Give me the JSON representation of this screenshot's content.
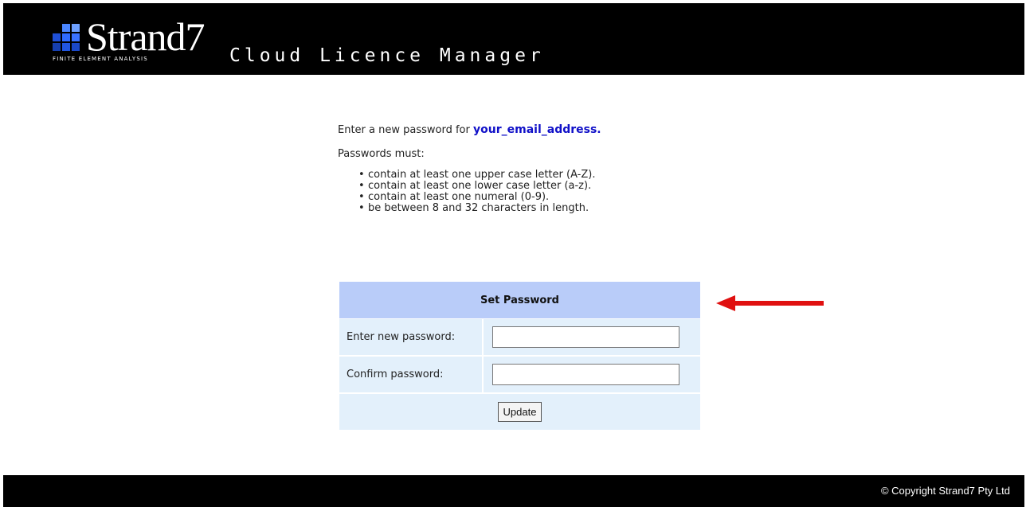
{
  "header": {
    "logo_word": "Strand7",
    "logo_tagline": "FINITE ELEMENT ANALYSIS",
    "app_title": "Cloud Licence Manager"
  },
  "content": {
    "intro_text": "Enter a new password for",
    "email": "your_email_address.",
    "musts_heading": "Passwords must:",
    "rules": [
      "contain at least one upper case letter (A-Z).",
      "contain at least one lower case letter (a-z).",
      "contain at least one numeral (0-9).",
      "be between 8 and 32 characters in length."
    ]
  },
  "form": {
    "title": "Set Password",
    "new_password_label": "Enter new password:",
    "new_password_value": "",
    "confirm_password_label": "Confirm password:",
    "confirm_password_value": "",
    "update_label": "Update"
  },
  "footer": {
    "copyright": "© Copyright Strand7 Pty Ltd"
  },
  "colors": {
    "header_bg": "#000000",
    "form_header_bg": "#b9ccf9",
    "form_row_bg": "#e3f0fb",
    "email_link": "#1010c8",
    "arrow": "#e01010",
    "logo_blue": "#1f4fd6"
  },
  "icons": {
    "logo": "strand7-logo-squares",
    "annotation": "red-arrow-left-icon"
  }
}
